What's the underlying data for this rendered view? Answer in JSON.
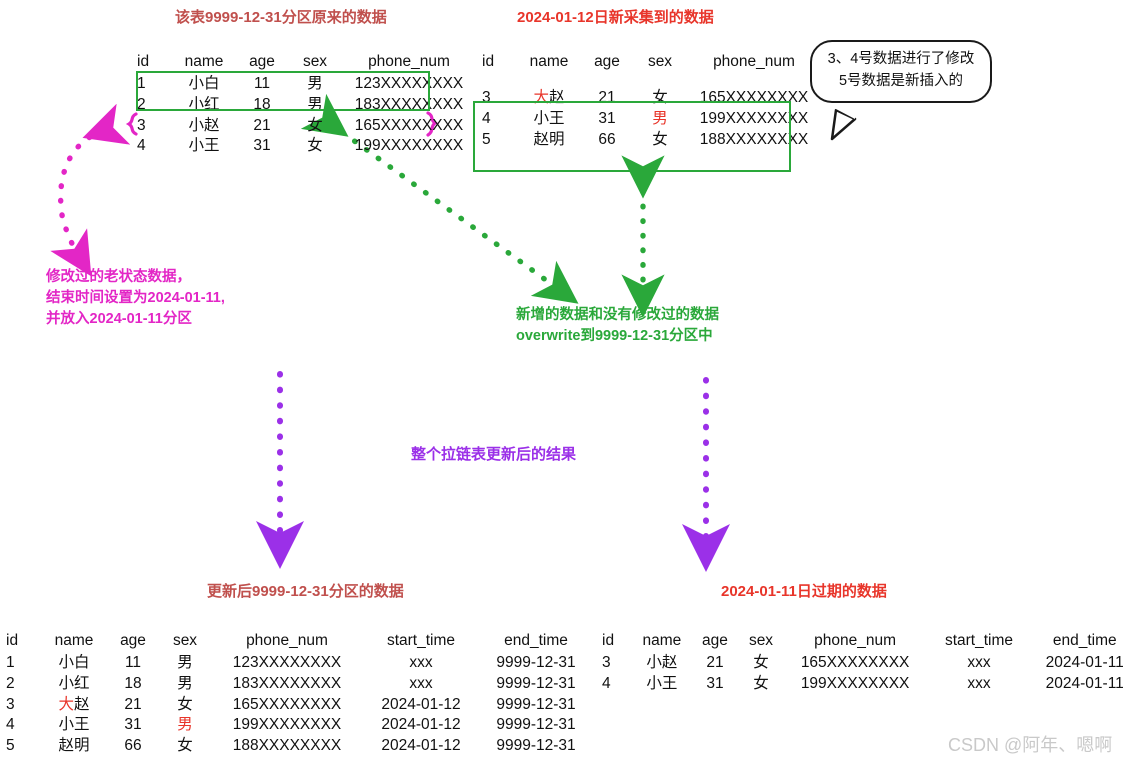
{
  "page": {
    "watermark": "CSDN @阿年、嗯啊"
  },
  "original_table": {
    "title": "该表9999-12-31分区原来的数据",
    "columns": [
      "id",
      "name",
      "age",
      "sex",
      "phone_num"
    ],
    "rows": [
      {
        "id": "1",
        "name": "小白",
        "age": "11",
        "sex": "男",
        "phone_num": "123XXXXXXXX",
        "highlight": "none"
      },
      {
        "id": "2",
        "name": "小红",
        "age": "18",
        "sex": "男",
        "phone_num": "183XXXXXXXX",
        "highlight": "none"
      },
      {
        "id": "3",
        "name": "小赵",
        "age": "21",
        "sex": "女",
        "phone_num": "165XXXXXXXX",
        "highlight": "none"
      },
      {
        "id": "4",
        "name": "小王",
        "age": "31",
        "sex": "女",
        "phone_num": "199XXXXXXXX",
        "highlight": "none"
      }
    ]
  },
  "new_table": {
    "title": "2024-01-12日新采集到的数据",
    "columns": [
      "id",
      "name",
      "age",
      "sex",
      "phone_num"
    ],
    "rows": [
      {
        "id": "3",
        "name_red": "大",
        "name_rest": "赵",
        "age": "21",
        "sex": "女",
        "sex_red": false,
        "phone_num": "165XXXXXXXX"
      },
      {
        "id": "4",
        "name_red": "",
        "name_rest": "小王",
        "age": "31",
        "sex": "男",
        "sex_red": true,
        "phone_num": "199XXXXXXXX"
      },
      {
        "id": "5",
        "name_red": "",
        "name_rest": "赵明",
        "age": "66",
        "sex": "女",
        "sex_red": false,
        "phone_num": "188XXXXXXXX"
      }
    ]
  },
  "callout": {
    "text": "3、4号数据进行了修改\n5号数据是新插入的"
  },
  "note_old_state": {
    "text": "修改过的老状态数据，\n结束时间设置为2024-01-11,\n并放入2024-01-11分区"
  },
  "note_overwrite": {
    "text": "新增的数据和没有修改过的数据\noverwrite到9999-12-31分区中"
  },
  "note_result": {
    "text": "整个拉链表更新后的结果"
  },
  "result_table": {
    "title": "更新后9999-12-31分区的数据",
    "columns": [
      "id",
      "name",
      "age",
      "sex",
      "phone_num",
      "start_time",
      "end_time"
    ],
    "rows": [
      {
        "id": "1",
        "name_red": "",
        "name_rest": "小白",
        "age": "11",
        "sex": "男",
        "sex_red": false,
        "phone_num": "123XXXXXXXX",
        "start_time": "xxx",
        "end_time": "9999-12-31"
      },
      {
        "id": "2",
        "name_red": "",
        "name_rest": "小红",
        "age": "18",
        "sex": "男",
        "sex_red": false,
        "phone_num": "183XXXXXXXX",
        "start_time": "xxx",
        "end_time": "9999-12-31"
      },
      {
        "id": "3",
        "name_red": "大",
        "name_rest": "赵",
        "age": "21",
        "sex": "女",
        "sex_red": false,
        "phone_num": "165XXXXXXXX",
        "start_time": "2024-01-12",
        "end_time": "9999-12-31"
      },
      {
        "id": "4",
        "name_red": "",
        "name_rest": "小王",
        "age": "31",
        "sex": "男",
        "sex_red": true,
        "phone_num": "199XXXXXXXX",
        "start_time": "2024-01-12",
        "end_time": "9999-12-31"
      },
      {
        "id": "5",
        "name_red": "",
        "name_rest": "赵明",
        "age": "66",
        "sex": "女",
        "sex_red": false,
        "phone_num": "188XXXXXXXX",
        "start_time": "2024-01-12",
        "end_time": "9999-12-31"
      }
    ]
  },
  "expired_table": {
    "title": "2024-01-11日过期的数据",
    "columns": [
      "id",
      "name",
      "age",
      "sex",
      "phone_num",
      "start_time",
      "end_time"
    ],
    "rows": [
      {
        "id": "3",
        "name_red": "",
        "name_rest": "小赵",
        "age": "21",
        "sex": "女",
        "sex_red": false,
        "phone_num": "165XXXXXXXX",
        "start_time": "xxx",
        "end_time": "2024-01-11"
      },
      {
        "id": "4",
        "name_red": "",
        "name_rest": "小王",
        "age": "31",
        "sex": "女",
        "sex_red": false,
        "phone_num": "199XXXXXXXX",
        "start_time": "xxx",
        "end_time": "2024-01-11"
      }
    ]
  },
  "colors": {
    "title_dark_red": "#c0504d",
    "title_bright_red": "#e8352a",
    "green": "#2aa83a",
    "magenta": "#e326c6",
    "purple": "#9b30e8",
    "text": "#111111",
    "watermark": "#c9c9c9"
  }
}
